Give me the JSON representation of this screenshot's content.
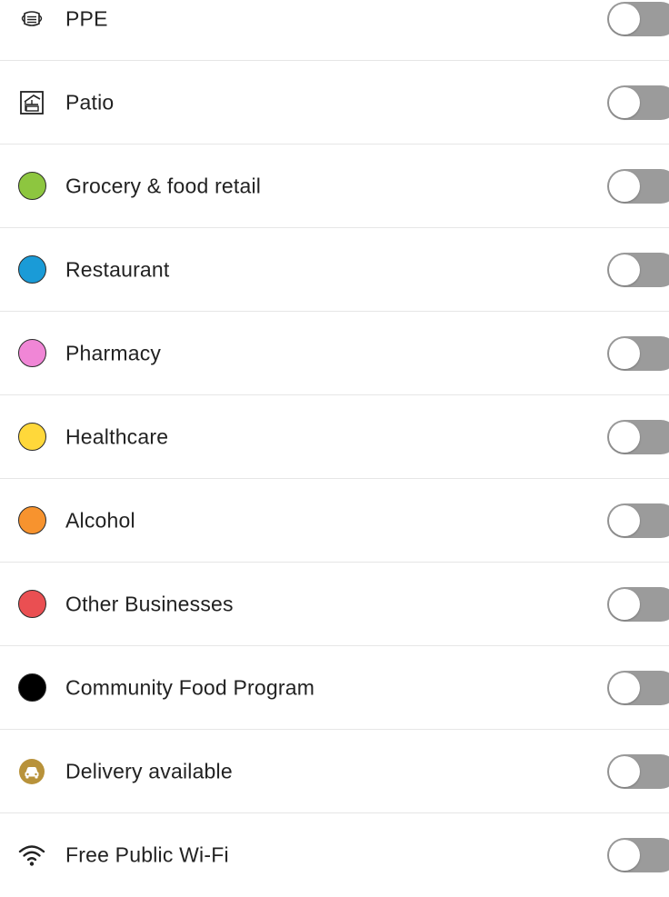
{
  "filters": [
    {
      "label": "PPE",
      "icon": "ppe-mask-icon",
      "enabled": false
    },
    {
      "label": "Patio",
      "icon": "patio-icon",
      "enabled": false
    },
    {
      "label": "Grocery & food retail",
      "icon": "category-dot-icon",
      "color": "#8dc63f",
      "enabled": false
    },
    {
      "label": "Restaurant",
      "icon": "category-dot-icon",
      "color": "#1a9bd7",
      "enabled": false
    },
    {
      "label": "Pharmacy",
      "icon": "category-dot-icon",
      "color": "#f086d6",
      "enabled": false
    },
    {
      "label": "Healthcare",
      "icon": "category-dot-icon",
      "color": "#ffd83a",
      "enabled": false
    },
    {
      "label": "Alcohol",
      "icon": "category-dot-icon",
      "color": "#f7932e",
      "enabled": false
    },
    {
      "label": "Other Businesses",
      "icon": "category-dot-icon",
      "color": "#ea4f52",
      "enabled": false
    },
    {
      "label": "Community Food Program",
      "icon": "category-dot-icon",
      "color": "#000000",
      "enabled": false
    },
    {
      "label": "Delivery available",
      "icon": "delivery-car-icon",
      "color": "#b8923a",
      "enabled": false
    },
    {
      "label": "Free Public Wi-Fi",
      "icon": "wifi-icon",
      "enabled": false
    }
  ],
  "colors": {
    "toggle_off": "#9b9b9b",
    "knob": "#ffffff",
    "divider": "#e6e6e6"
  }
}
